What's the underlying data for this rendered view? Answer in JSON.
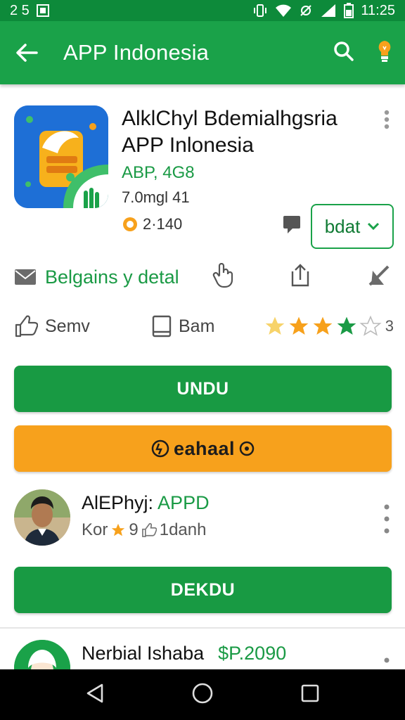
{
  "status": {
    "left_text": "2 5",
    "time": "11:25"
  },
  "appbar": {
    "title": "APP Indonesia",
    "icons": [
      "back-arrow-icon",
      "search-icon",
      "bulb-icon"
    ]
  },
  "app": {
    "title": "AlklChyl Bdemialhgsria APP Inlonesia",
    "category": "ABP, 4G8",
    "size": "7.0mgl 41",
    "rating_count": "2·140",
    "install_label": "bdat"
  },
  "actions": {
    "mail_label": "Belgains y detal"
  },
  "tabs": {
    "save_label": "Semv",
    "ban_label": "Bam",
    "stars_filled": 4,
    "stars_total": 5,
    "rating_num": "3"
  },
  "buttons": {
    "primary": "UNDU",
    "secondary": "eahaal",
    "tertiary": "DEKDU"
  },
  "reviews": [
    {
      "name": "AlEPhyj:",
      "tag": "APPD",
      "meta_prefix": "Kor",
      "meta_rating": "9",
      "meta_time": "1danh"
    },
    {
      "name": "Nerbial Ishaba",
      "tag": "$P.2090"
    }
  ],
  "colors": {
    "primary_green": "#1aa249",
    "dark_green": "#0d8a3a",
    "orange": "#f7a11c",
    "star_gold": "#f7b11c",
    "star_green": "#1a9a45"
  }
}
